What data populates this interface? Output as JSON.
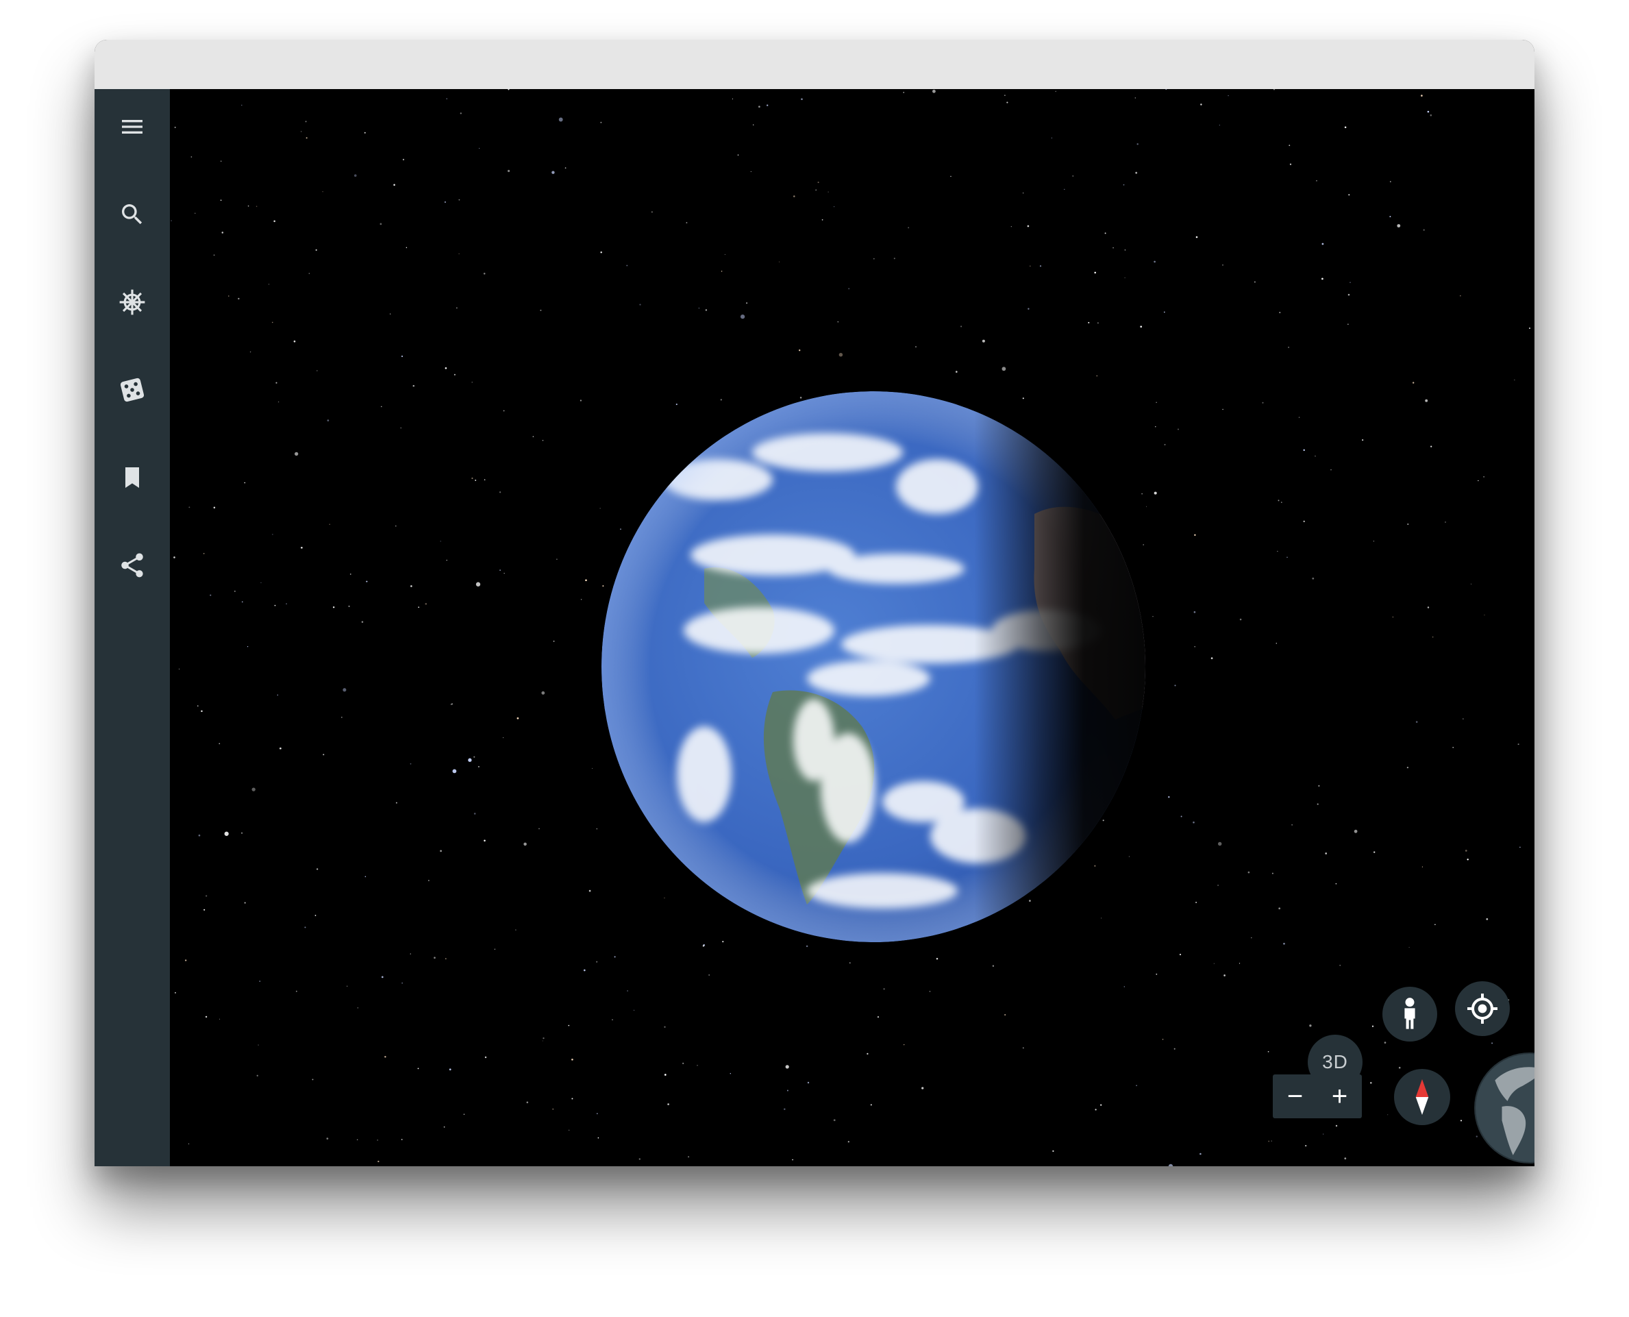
{
  "window": {
    "title": ""
  },
  "sidebar": {
    "items": [
      {
        "name": "menu",
        "icon": "menu-icon"
      },
      {
        "name": "search",
        "icon": "search-icon"
      },
      {
        "name": "voyager",
        "icon": "ship-wheel-icon"
      },
      {
        "name": "feeling-lucky",
        "icon": "dice-icon"
      },
      {
        "name": "projects",
        "icon": "bookmark-icon"
      },
      {
        "name": "share",
        "icon": "share-icon"
      }
    ]
  },
  "controls": {
    "view_3d_label": "3D",
    "zoom_out_label": "−",
    "zoom_in_label": "+",
    "pegman_icon": "pegman-icon",
    "my_location_icon": "my-location-icon",
    "compass_icon": "compass-icon",
    "mini_globe_icon": "mini-globe-icon"
  },
  "colors": {
    "sidebar_bg": "#263238",
    "titlebar_bg": "#e6e6e6",
    "space_bg": "#000000",
    "ocean": "#3d6cc4",
    "compass_north": "#e53935"
  }
}
